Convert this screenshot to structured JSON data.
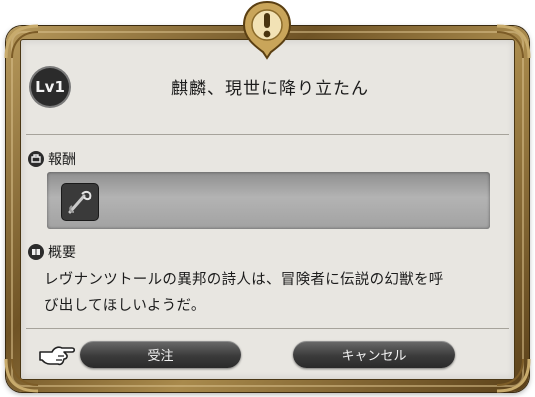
{
  "dialog": {
    "level": "Lv1",
    "title": "麒麟、現世に降り立たん"
  },
  "reward": {
    "label": "報酬",
    "item_icon": "tool-icon"
  },
  "summary": {
    "label": "概要",
    "line1": "レヴナンツトールの異邦の詩人は、冒険者に伝説の幻獣を呼",
    "line2": "び出してほしいようだ。"
  },
  "buttons": {
    "accept": "受注",
    "cancel": "キャンセル"
  },
  "colors": {
    "frame_gold": "#a98a4c",
    "panel_bg": "#e8e6e1",
    "button_dark": "#3b3b3b"
  }
}
